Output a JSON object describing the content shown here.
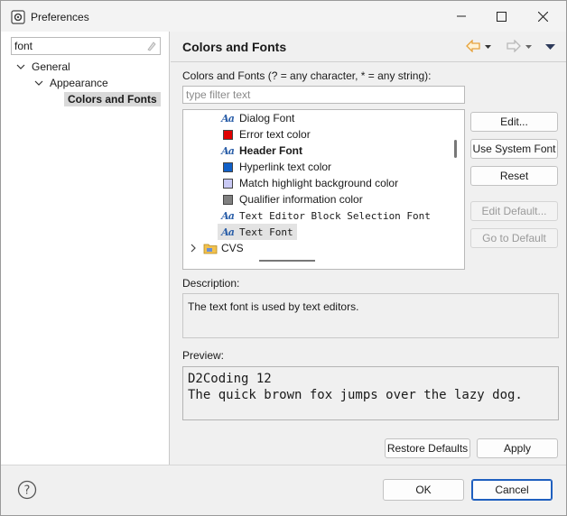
{
  "window": {
    "title": "Preferences"
  },
  "search": {
    "value": "font"
  },
  "tree": {
    "general": "General",
    "appearance": "Appearance",
    "colors_fonts": "Colors and Fonts"
  },
  "page": {
    "title": "Colors and Fonts",
    "filter_caption": "Colors and Fonts (? = any character, * = any string):",
    "filter_placeholder": "type filter text"
  },
  "items": [
    {
      "label": "Dialog Font",
      "kind": "font",
      "bold": false,
      "mono": false
    },
    {
      "label": "Error text color",
      "kind": "color",
      "color": "#e00000"
    },
    {
      "label": "Header Font",
      "kind": "font",
      "bold": true,
      "mono": false
    },
    {
      "label": "Hyperlink text color",
      "kind": "color",
      "color": "#1060c8"
    },
    {
      "label": "Match highlight background color",
      "kind": "color",
      "color": "#c9c9f4"
    },
    {
      "label": "Qualifier information color",
      "kind": "color",
      "color": "#808080"
    },
    {
      "label": "Text Editor Block Selection Font",
      "kind": "font",
      "bold": false,
      "mono": true
    },
    {
      "label": "Text Font",
      "kind": "font",
      "bold": false,
      "mono": true,
      "selected": true
    }
  ],
  "cvs": {
    "label": "CVS"
  },
  "buttons": {
    "edit": "Edit...",
    "use_system": "Use System Font",
    "reset": "Reset",
    "edit_default": "Edit Default...",
    "go_default": "Go to Default",
    "restore": "Restore Defaults",
    "apply": "Apply",
    "ok": "OK",
    "cancel": "Cancel"
  },
  "description": {
    "label": "Description:",
    "text": "The text font is used by text editors."
  },
  "preview": {
    "label": "Preview:",
    "line1": "D2Coding 12",
    "line2": "The quick brown fox jumps over the lazy dog."
  },
  "colors": {
    "nav_arrow": "#e6a23c",
    "accent": "#1f5fbf"
  }
}
